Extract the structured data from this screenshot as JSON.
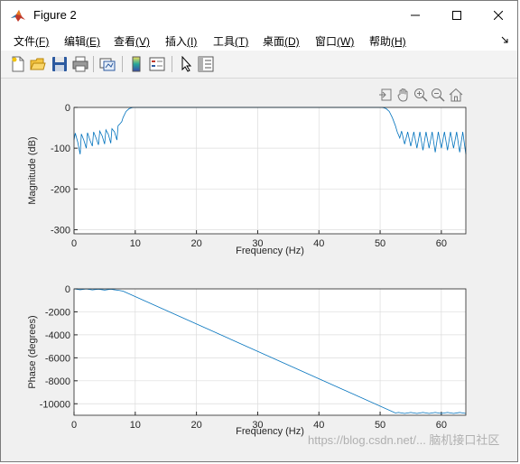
{
  "window": {
    "title": "Figure 2"
  },
  "menu": {
    "items": [
      {
        "label": "文件",
        "key": "(F)"
      },
      {
        "label": "编辑",
        "key": "(E)"
      },
      {
        "label": "查看",
        "key": "(V)"
      },
      {
        "label": "插入",
        "key": "(I)"
      },
      {
        "label": "工具",
        "key": "(T)"
      },
      {
        "label": "桌面",
        "key": "(D)"
      },
      {
        "label": "窗口",
        "key": "(W)"
      },
      {
        "label": "帮助",
        "key": "(H)"
      }
    ]
  },
  "toolbar": {
    "icons": [
      "new-figure-icon",
      "open-file-icon",
      "save-icon",
      "print-icon",
      "link-plot-icon",
      "colorbar-icon",
      "legend-icon",
      "edit-plot-pointer-icon",
      "property-inspector-icon"
    ]
  },
  "axes_toolbar": {
    "icons": [
      "export-icon",
      "pan-hand-icon",
      "zoom-in-icon",
      "zoom-out-icon",
      "restore-home-icon"
    ]
  },
  "colors": {
    "line": "#0072bd",
    "grid": "#dcdcdc",
    "axes_bg": "#ffffff",
    "figure_bg": "#f0f0f0"
  },
  "chart_data": [
    {
      "type": "line",
      "xlabel": "Frequency (Hz)",
      "ylabel": "Magnitude (dB)",
      "xlim": [
        0,
        64
      ],
      "ylim": [
        -310,
        0
      ],
      "xticks": [
        "0",
        "10",
        "20",
        "30",
        "40",
        "50",
        "60"
      ],
      "yticks": [
        "0",
        "-100",
        "-200",
        "-300"
      ],
      "grid": true,
      "series": [
        {
          "x": [
            0,
            0.2,
            0.6,
            1.0,
            1.2,
            1.6,
            2.0,
            2.2,
            2.6,
            3.0,
            3.2,
            3.6,
            4.0,
            4.2,
            4.6,
            5.0,
            5.2,
            5.6,
            6.0,
            6.2,
            6.6,
            7.0,
            7.2,
            7.5,
            7.8,
            8.0,
            8.5,
            9.0,
            9.5,
            10.0,
            20,
            30,
            40,
            50,
            50.5,
            51.0,
            51.5,
            52.0,
            52.5,
            52.8,
            53.2,
            53.5,
            54.0,
            54.5,
            55.0,
            55.5,
            56.0,
            56.5,
            57.0,
            57.5,
            58.0,
            58.5,
            59.0,
            59.5,
            60.0,
            60.5,
            61.0,
            61.5,
            62.0,
            62.5,
            63.0,
            63.5,
            64.0
          ],
          "y": [
            -80,
            -63,
            -85,
            -115,
            -65,
            -80,
            -100,
            -62,
            -80,
            -95,
            -60,
            -75,
            -92,
            -58,
            -70,
            -90,
            -55,
            -66,
            -88,
            -52,
            -60,
            -80,
            -45,
            -40,
            -35,
            -25,
            -10,
            -3,
            -0.5,
            0,
            0,
            0,
            0,
            0,
            -0.5,
            -3,
            -10,
            -25,
            -45,
            -60,
            -75,
            -58,
            -90,
            -60,
            -95,
            -60,
            -100,
            -60,
            -105,
            -60,
            -100,
            -60,
            -110,
            -60,
            -100,
            -60,
            -105,
            -60,
            -100,
            -60,
            -110,
            -60,
            -115
          ]
        }
      ]
    },
    {
      "type": "line",
      "xlabel": "Frequency (Hz)",
      "ylabel": "Phase (degrees)",
      "xlim": [
        0,
        64
      ],
      "ylim": [
        -11000,
        0
      ],
      "xticks": [
        "0",
        "10",
        "20",
        "30",
        "40",
        "50",
        "60"
      ],
      "yticks": [
        "0",
        "-2000",
        "-4000",
        "-6000",
        "-8000",
        "-10000"
      ],
      "grid": true,
      "series": [
        {
          "x": [
            0,
            1,
            2,
            3,
            4,
            5,
            6,
            7,
            7.5,
            8,
            52.5,
            53,
            54,
            55,
            56,
            57,
            58,
            59,
            60,
            61,
            62,
            63,
            64
          ],
          "y": [
            0,
            -80,
            -10,
            -90,
            -20,
            -100,
            -30,
            -110,
            -150,
            -200,
            -10800,
            -10760,
            -10840,
            -10760,
            -10840,
            -10760,
            -10840,
            -10760,
            -10840,
            -10760,
            -10840,
            -10760,
            -10840
          ]
        }
      ]
    }
  ],
  "watermark": {
    "text": "https://blog.csdn.net/... 脑机接口社区"
  }
}
